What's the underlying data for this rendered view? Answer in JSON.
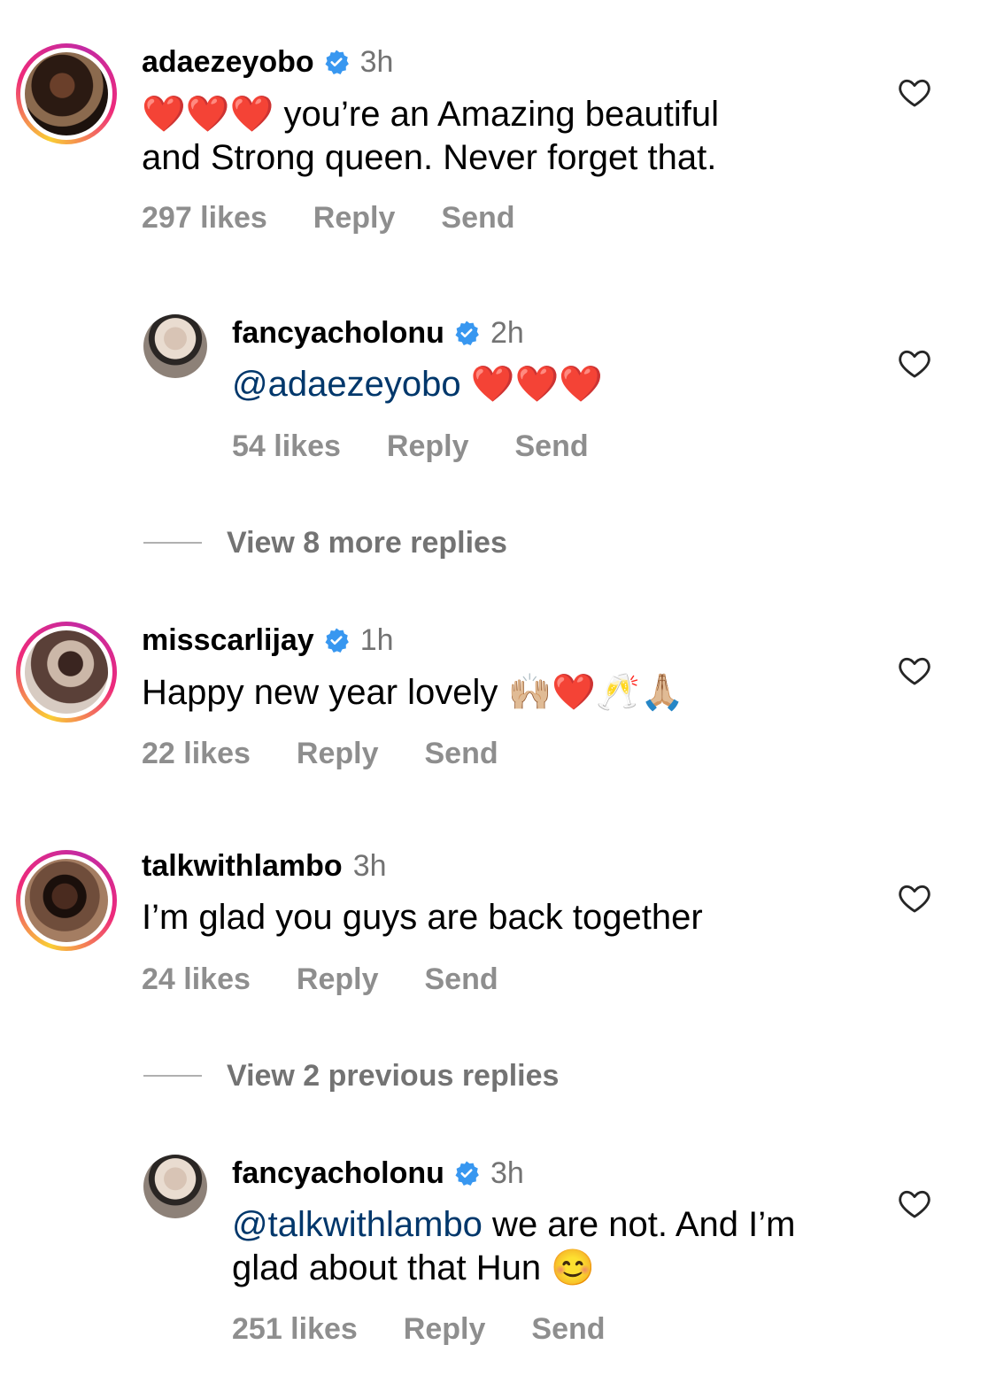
{
  "comments": [
    {
      "username": "adaezeyobo",
      "time": "3h",
      "text_emoji": "❤️❤️❤️",
      "text_line1": " you’re an Amazing beautiful",
      "text_line2": "and Strong queen. Never forget that.",
      "likes": "297 likes",
      "reply": "Reply",
      "send": "Send"
    },
    {
      "username": "fancyacholonu",
      "time": "2h",
      "mention": "@adaezeyobo",
      "text_emoji": " ❤️❤️❤️",
      "likes": "54 likes",
      "reply": "Reply",
      "send": "Send"
    },
    {
      "username": "misscarlijay",
      "time": "1h",
      "text": "Happy new year lovely ",
      "text_emoji": "🙌🏼❤️🥂🙏🏼",
      "likes": "22 likes",
      "reply": "Reply",
      "send": "Send"
    },
    {
      "username": "talkwithlambo",
      "time": "3h",
      "text": "I’m glad you guys are back together",
      "likes": "24 likes",
      "reply": "Reply",
      "send": "Send"
    },
    {
      "username": "fancyacholonu",
      "time": "3h",
      "mention": "@talkwithlambo",
      "text_line1": " we are not. And I’m",
      "text_line2": "glad about that Hun ",
      "text_emoji": "😊",
      "likes": "251 likes",
      "reply": "Reply",
      "send": "Send"
    }
  ],
  "view_more_replies": "View 8 more replies",
  "view_previous_replies": "View 2 previous replies",
  "colors": {
    "verified": "#3897f0",
    "mention": "#00376b",
    "meta": "#8e8e8e"
  },
  "icons": [
    "verified-badge-icon",
    "heart-outline-icon"
  ]
}
